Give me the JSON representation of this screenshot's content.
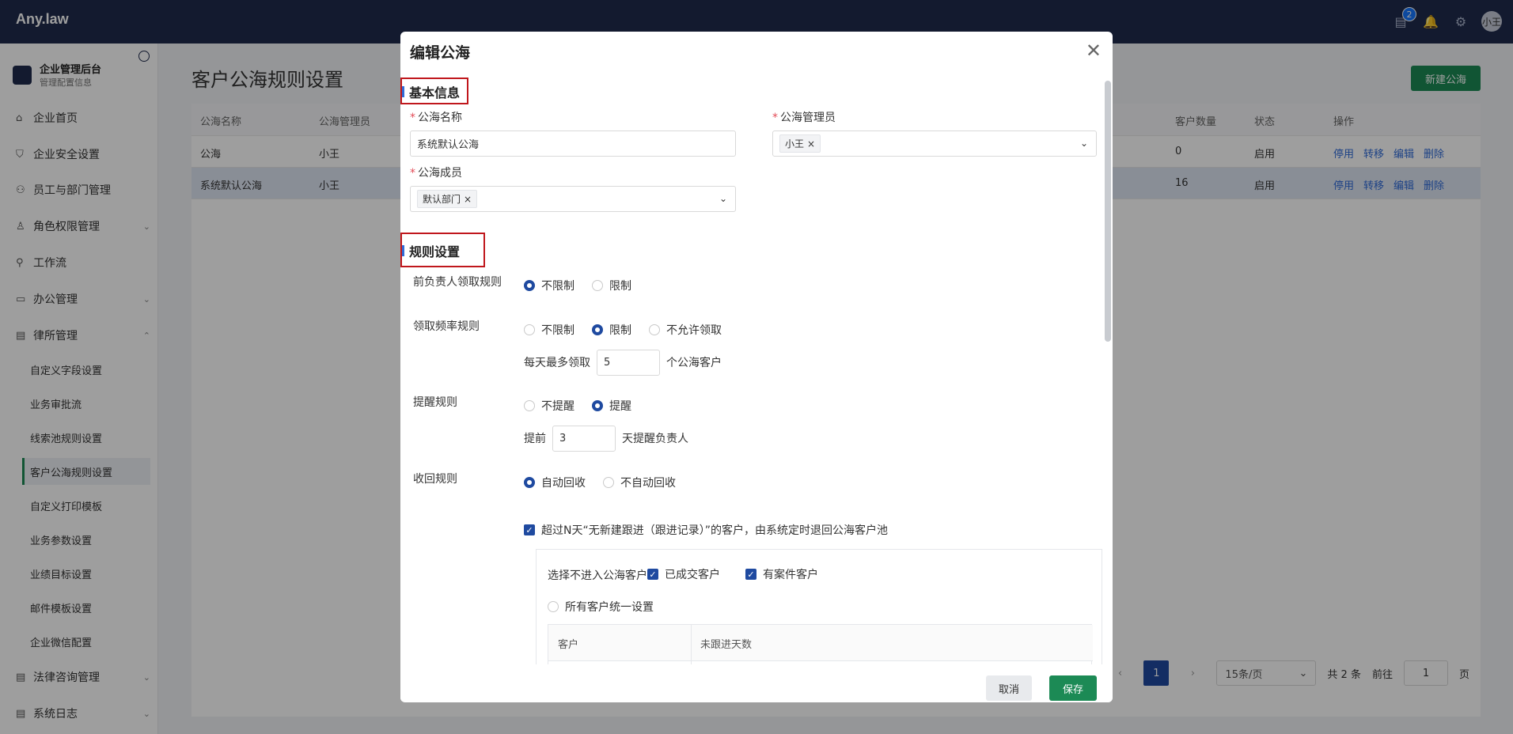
{
  "app": {
    "brand": "Any.law",
    "notif_count": "2",
    "avatar": "小王"
  },
  "sidebar": {
    "title": "企业管理后台",
    "subtitle": "管理配置信息",
    "items": [
      {
        "label": "企业首页",
        "icon": "home-icon"
      },
      {
        "label": "企业安全设置",
        "icon": "shield-icon"
      },
      {
        "label": "员工与部门管理",
        "icon": "users-icon"
      },
      {
        "label": "角色权限管理",
        "icon": "role-icon"
      },
      {
        "label": "工作流",
        "icon": "workflow-icon"
      },
      {
        "label": "办公管理",
        "icon": "briefcase-icon"
      },
      {
        "label": "律所管理",
        "icon": "book-icon"
      },
      {
        "label": "法律咨询管理",
        "icon": "doc-icon"
      },
      {
        "label": "系统日志",
        "icon": "log-icon"
      }
    ],
    "subitems": [
      "自定义字段设置",
      "业务审批流",
      "线索池规则设置",
      "客户公海规则设置",
      "自定义打印模板",
      "业务参数设置",
      "业绩目标设置",
      "邮件模板设置",
      "企业微信配置"
    ]
  },
  "main": {
    "title": "客户公海规则设置",
    "new_button": "新建公海",
    "columns": [
      "公海名称",
      "公海管理员",
      "客户数量",
      "状态",
      "操作"
    ],
    "rows": [
      {
        "name": "公海",
        "admin": "小王",
        "count": "0",
        "status": "启用"
      },
      {
        "name": "系统默认公海",
        "admin": "小王",
        "count": "16",
        "status": "启用"
      }
    ],
    "ops": [
      "停用",
      "转移",
      "编辑",
      "删除"
    ],
    "pager": {
      "current": "1",
      "page_size": "15条/页",
      "total": "共 2 条",
      "goto_label": "前往",
      "goto_value": "1",
      "page_unit": "页"
    }
  },
  "modal": {
    "title": "编辑公海",
    "section_basic": "基本信息",
    "name_label": "公海名称",
    "name_value": "系统默认公海",
    "admin_label": "公海管理员",
    "admin_tag": "小王",
    "members_label": "公海成员",
    "members_tag": "默认部门",
    "section_rules": "规则设置",
    "rule1": {
      "label": "前负责人领取规则",
      "options": [
        "不限制",
        "限制"
      ],
      "selected": 0
    },
    "rule2": {
      "label": "领取频率规则",
      "options": [
        "不限制",
        "限制",
        "不允许领取"
      ],
      "selected": 1,
      "prefix": "每天最多领取",
      "value": "5",
      "suffix": "个公海客户"
    },
    "rule3": {
      "label": "提醒规则",
      "options": [
        "不提醒",
        "提醒"
      ],
      "selected": 1,
      "prefix": "提前",
      "value": "3",
      "suffix": "天提醒负责人"
    },
    "rule4": {
      "label": "收回规则",
      "options": [
        "自动回收",
        "不自动回收"
      ],
      "selected": 0
    },
    "recycle_check": "超过N天“无新建跟进（跟进记录）”的客户，由系统定时退回公海客户池",
    "exclude_label": "选择不进入公海客户",
    "exclude_opts": [
      "已成交客户",
      "有案件客户"
    ],
    "unified": "所有客户统一设置",
    "inner_cols": [
      "客户",
      "未跟进天数"
    ],
    "cancel": "取消",
    "save": "保存"
  }
}
